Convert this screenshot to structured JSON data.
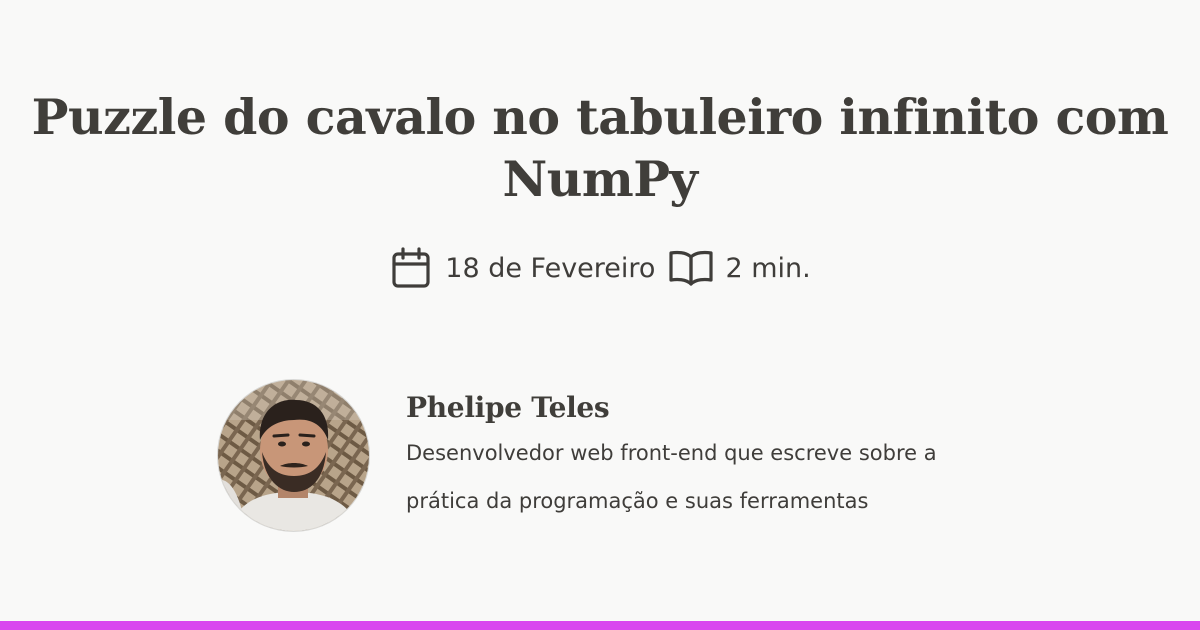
{
  "post": {
    "title": "Puzzle do cavalo no tabuleiro infinito com NumPy",
    "date": "18 de Fevereiro",
    "reading_time": "2 min."
  },
  "icons": {
    "date": "calendar-icon",
    "reading_time": "open-book-icon"
  },
  "author": {
    "name": "Phelipe Teles",
    "bio": "Desenvolvedor web front-end que escreve sobre a prática da programação e suas ferramentas",
    "avatar": "author-photo"
  },
  "colors": {
    "background": "#f9f9f8",
    "text": "#3f3d3a",
    "accent": "#d946ef"
  }
}
